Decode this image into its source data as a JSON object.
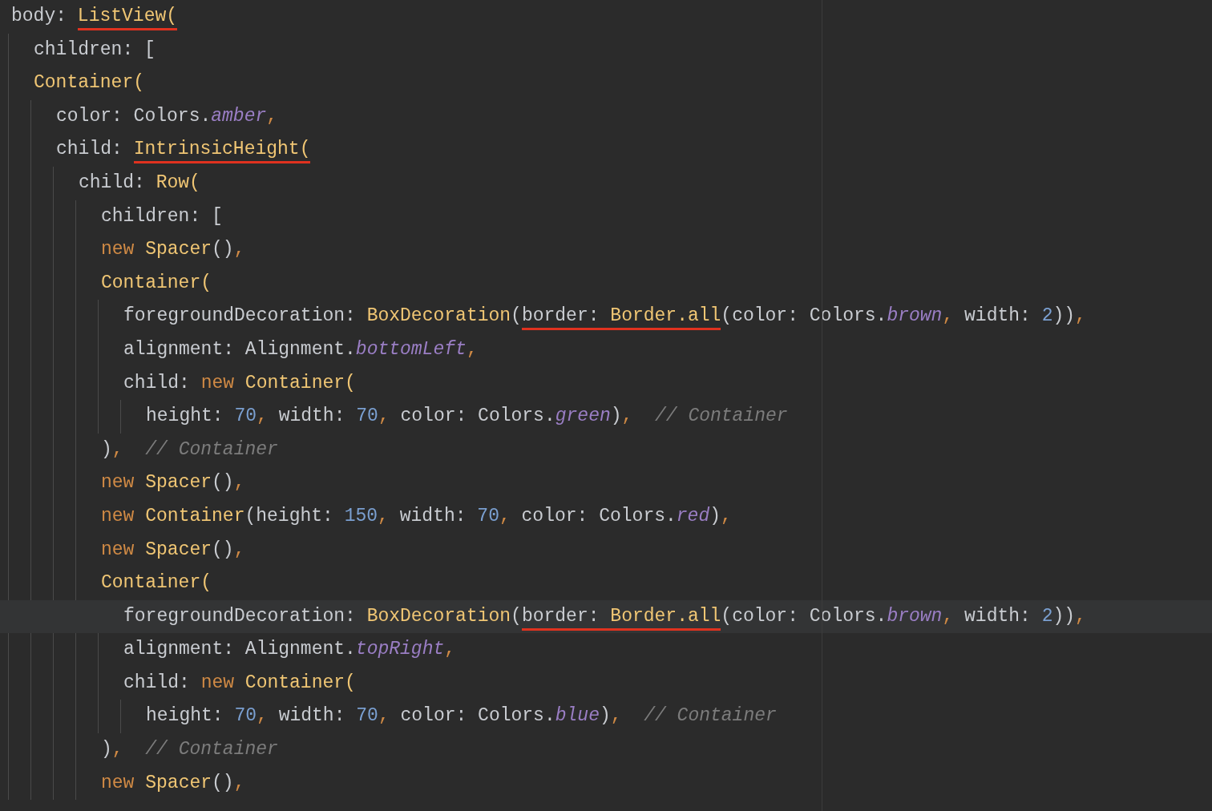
{
  "lines": [
    {
      "tokens": [
        {
          "kind": "plain",
          "s": "body: "
        },
        {
          "kind": "cls",
          "s": "ListView(",
          "underlined": true
        }
      ],
      "children": [
        {
          "tokens": [
            {
              "kind": "plain",
              "s": "children: ["
            }
          ]
        },
        {
          "tokens": [
            {
              "kind": "cls",
              "s": "Container("
            }
          ],
          "children": [
            {
              "tokens": [
                {
                  "kind": "plain",
                  "s": "color: Colors."
                },
                {
                  "kind": "const",
                  "s": "amber"
                },
                {
                  "kind": "kw",
                  "s": ","
                }
              ]
            },
            {
              "tokens": [
                {
                  "kind": "plain",
                  "s": "child: "
                },
                {
                  "kind": "cls",
                  "s": "IntrinsicHeight(",
                  "underlined": true
                }
              ],
              "children": [
                {
                  "tokens": [
                    {
                      "kind": "plain",
                      "s": "child: "
                    },
                    {
                      "kind": "cls",
                      "s": "Row("
                    }
                  ],
                  "children": [
                    {
                      "tokens": [
                        {
                          "kind": "plain",
                          "s": "children: ["
                        }
                      ]
                    },
                    {
                      "tokens": [
                        {
                          "kind": "kw",
                          "s": "new "
                        },
                        {
                          "kind": "cls",
                          "s": "Spacer"
                        },
                        {
                          "kind": "plain",
                          "s": "()"
                        },
                        {
                          "kind": "kw",
                          "s": ","
                        }
                      ]
                    },
                    {
                      "tokens": [
                        {
                          "kind": "cls",
                          "s": "Container("
                        }
                      ],
                      "children": [
                        {
                          "tokens": [
                            {
                              "kind": "plain",
                              "s": "foregroundDecoration: "
                            },
                            {
                              "kind": "cls",
                              "s": "BoxDecoration"
                            },
                            {
                              "kind": "plain",
                              "s": "("
                            },
                            {
                              "kind": "plain",
                              "s": "border: ",
                              "underlined": true
                            },
                            {
                              "kind": "cls",
                              "s": "Border.all",
                              "underlined": true
                            },
                            {
                              "kind": "plain",
                              "s": "(color: Colors."
                            },
                            {
                              "kind": "const",
                              "s": "brown"
                            },
                            {
                              "kind": "kw",
                              "s": ", "
                            },
                            {
                              "kind": "plain",
                              "s": "width: "
                            },
                            {
                              "kind": "num",
                              "s": "2"
                            },
                            {
                              "kind": "plain",
                              "s": "))"
                            },
                            {
                              "kind": "kw",
                              "s": ","
                            }
                          ]
                        },
                        {
                          "tokens": [
                            {
                              "kind": "plain",
                              "s": "alignment: Alignment."
                            },
                            {
                              "kind": "const",
                              "s": "bottomLeft"
                            },
                            {
                              "kind": "kw",
                              "s": ","
                            }
                          ]
                        },
                        {
                          "tokens": [
                            {
                              "kind": "plain",
                              "s": "child: "
                            },
                            {
                              "kind": "kw",
                              "s": "new "
                            },
                            {
                              "kind": "cls",
                              "s": "Container("
                            }
                          ],
                          "children": [
                            {
                              "tokens": [
                                {
                                  "kind": "plain",
                                  "s": "height: "
                                },
                                {
                                  "kind": "num",
                                  "s": "70"
                                },
                                {
                                  "kind": "kw",
                                  "s": ", "
                                },
                                {
                                  "kind": "plain",
                                  "s": "width: "
                                },
                                {
                                  "kind": "num",
                                  "s": "70"
                                },
                                {
                                  "kind": "kw",
                                  "s": ", "
                                },
                                {
                                  "kind": "plain",
                                  "s": "color: Colors."
                                },
                                {
                                  "kind": "const",
                                  "s": "green"
                                },
                                {
                                  "kind": "plain",
                                  "s": ")"
                                },
                                {
                                  "kind": "kw",
                                  "s": ",  "
                                },
                                {
                                  "kind": "comment",
                                  "s": "// Container"
                                }
                              ]
                            }
                          ]
                        }
                      ]
                    },
                    {
                      "tokens": [
                        {
                          "kind": "plain",
                          "s": ")"
                        },
                        {
                          "kind": "kw",
                          "s": ",  "
                        },
                        {
                          "kind": "comment",
                          "s": "// Container"
                        }
                      ]
                    },
                    {
                      "tokens": [
                        {
                          "kind": "kw",
                          "s": "new "
                        },
                        {
                          "kind": "cls",
                          "s": "Spacer"
                        },
                        {
                          "kind": "plain",
                          "s": "()"
                        },
                        {
                          "kind": "kw",
                          "s": ","
                        }
                      ]
                    },
                    {
                      "tokens": [
                        {
                          "kind": "kw",
                          "s": "new "
                        },
                        {
                          "kind": "cls",
                          "s": "Container"
                        },
                        {
                          "kind": "plain",
                          "s": "(height: "
                        },
                        {
                          "kind": "num",
                          "s": "150"
                        },
                        {
                          "kind": "kw",
                          "s": ", "
                        },
                        {
                          "kind": "plain",
                          "s": "width: "
                        },
                        {
                          "kind": "num",
                          "s": "70"
                        },
                        {
                          "kind": "kw",
                          "s": ", "
                        },
                        {
                          "kind": "plain",
                          "s": "color: Colors."
                        },
                        {
                          "kind": "const",
                          "s": "red"
                        },
                        {
                          "kind": "plain",
                          "s": ")"
                        },
                        {
                          "kind": "kw",
                          "s": ","
                        }
                      ]
                    },
                    {
                      "tokens": [
                        {
                          "kind": "kw",
                          "s": "new "
                        },
                        {
                          "kind": "cls",
                          "s": "Spacer"
                        },
                        {
                          "kind": "plain",
                          "s": "()"
                        },
                        {
                          "kind": "kw",
                          "s": ","
                        }
                      ]
                    },
                    {
                      "tokens": [
                        {
                          "kind": "cls",
                          "s": "Container("
                        }
                      ],
                      "children": [
                        {
                          "current": true,
                          "tokens": [
                            {
                              "kind": "plain",
                              "s": "foregroundDecoration: "
                            },
                            {
                              "kind": "cls",
                              "s": "BoxDecoration"
                            },
                            {
                              "kind": "plain",
                              "s": "("
                            },
                            {
                              "kind": "plain",
                              "s": "border: ",
                              "underlined": true
                            },
                            {
                              "kind": "cls",
                              "s": "Border.all",
                              "underlined": true
                            },
                            {
                              "kind": "plain",
                              "s": "(color: Colors."
                            },
                            {
                              "kind": "const",
                              "s": "brown"
                            },
                            {
                              "kind": "kw",
                              "s": ", "
                            },
                            {
                              "kind": "plain",
                              "s": "width: "
                            },
                            {
                              "kind": "num",
                              "s": "2"
                            },
                            {
                              "kind": "plain",
                              "s": "))"
                            },
                            {
                              "kind": "kw",
                              "s": ","
                            }
                          ]
                        },
                        {
                          "tokens": [
                            {
                              "kind": "plain",
                              "s": "alignment: Alignment."
                            },
                            {
                              "kind": "const",
                              "s": "topRight"
                            },
                            {
                              "kind": "kw",
                              "s": ","
                            }
                          ]
                        },
                        {
                          "tokens": [
                            {
                              "kind": "plain",
                              "s": "child: "
                            },
                            {
                              "kind": "kw",
                              "s": "new "
                            },
                            {
                              "kind": "cls",
                              "s": "Container("
                            }
                          ],
                          "children": [
                            {
                              "tokens": [
                                {
                                  "kind": "plain",
                                  "s": "height: "
                                },
                                {
                                  "kind": "num",
                                  "s": "70"
                                },
                                {
                                  "kind": "kw",
                                  "s": ", "
                                },
                                {
                                  "kind": "plain",
                                  "s": "width: "
                                },
                                {
                                  "kind": "num",
                                  "s": "70"
                                },
                                {
                                  "kind": "kw",
                                  "s": ", "
                                },
                                {
                                  "kind": "plain",
                                  "s": "color: Colors."
                                },
                                {
                                  "kind": "const",
                                  "s": "blue"
                                },
                                {
                                  "kind": "plain",
                                  "s": ")"
                                },
                                {
                                  "kind": "kw",
                                  "s": ",  "
                                },
                                {
                                  "kind": "comment",
                                  "s": "// Container"
                                }
                              ]
                            }
                          ]
                        }
                      ]
                    },
                    {
                      "tokens": [
                        {
                          "kind": "plain",
                          "s": ")"
                        },
                        {
                          "kind": "kw",
                          "s": ",  "
                        },
                        {
                          "kind": "comment",
                          "s": "// Container"
                        }
                      ]
                    },
                    {
                      "tokens": [
                        {
                          "kind": "kw",
                          "s": "new "
                        },
                        {
                          "kind": "cls",
                          "s": "Spacer"
                        },
                        {
                          "kind": "plain",
                          "s": "()"
                        },
                        {
                          "kind": "kw",
                          "s": ","
                        }
                      ]
                    }
                  ]
                }
              ]
            }
          ]
        }
      ]
    }
  ]
}
